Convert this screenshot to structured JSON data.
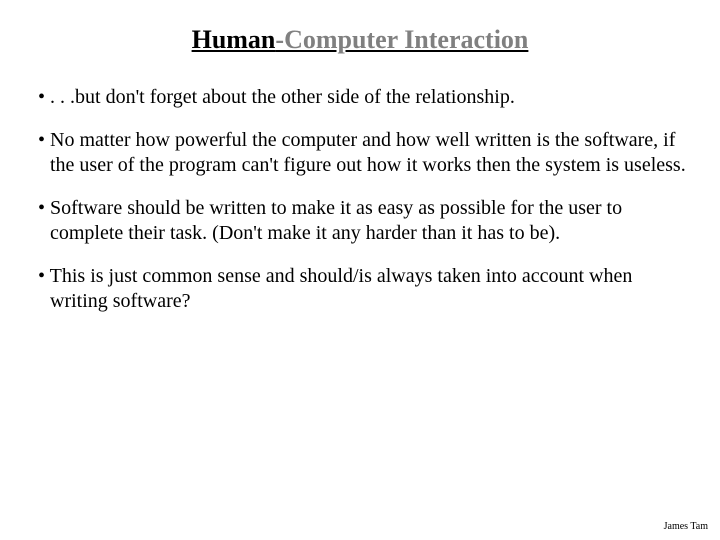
{
  "title": {
    "part1": "Human",
    "part2": "-Computer Interaction"
  },
  "bullets": [
    ". . .but don't forget about the other side of the relationship.",
    "No matter how powerful the computer and how well written is the software, if the user of the program can't figure out how it works then the system is useless.",
    "Software should be written to make it as easy as possible for the user to complete their task.  (Don't make it any harder than it has to be).",
    "This is just common sense and should/is always taken into account when writing software?"
  ],
  "footer": "James Tam"
}
